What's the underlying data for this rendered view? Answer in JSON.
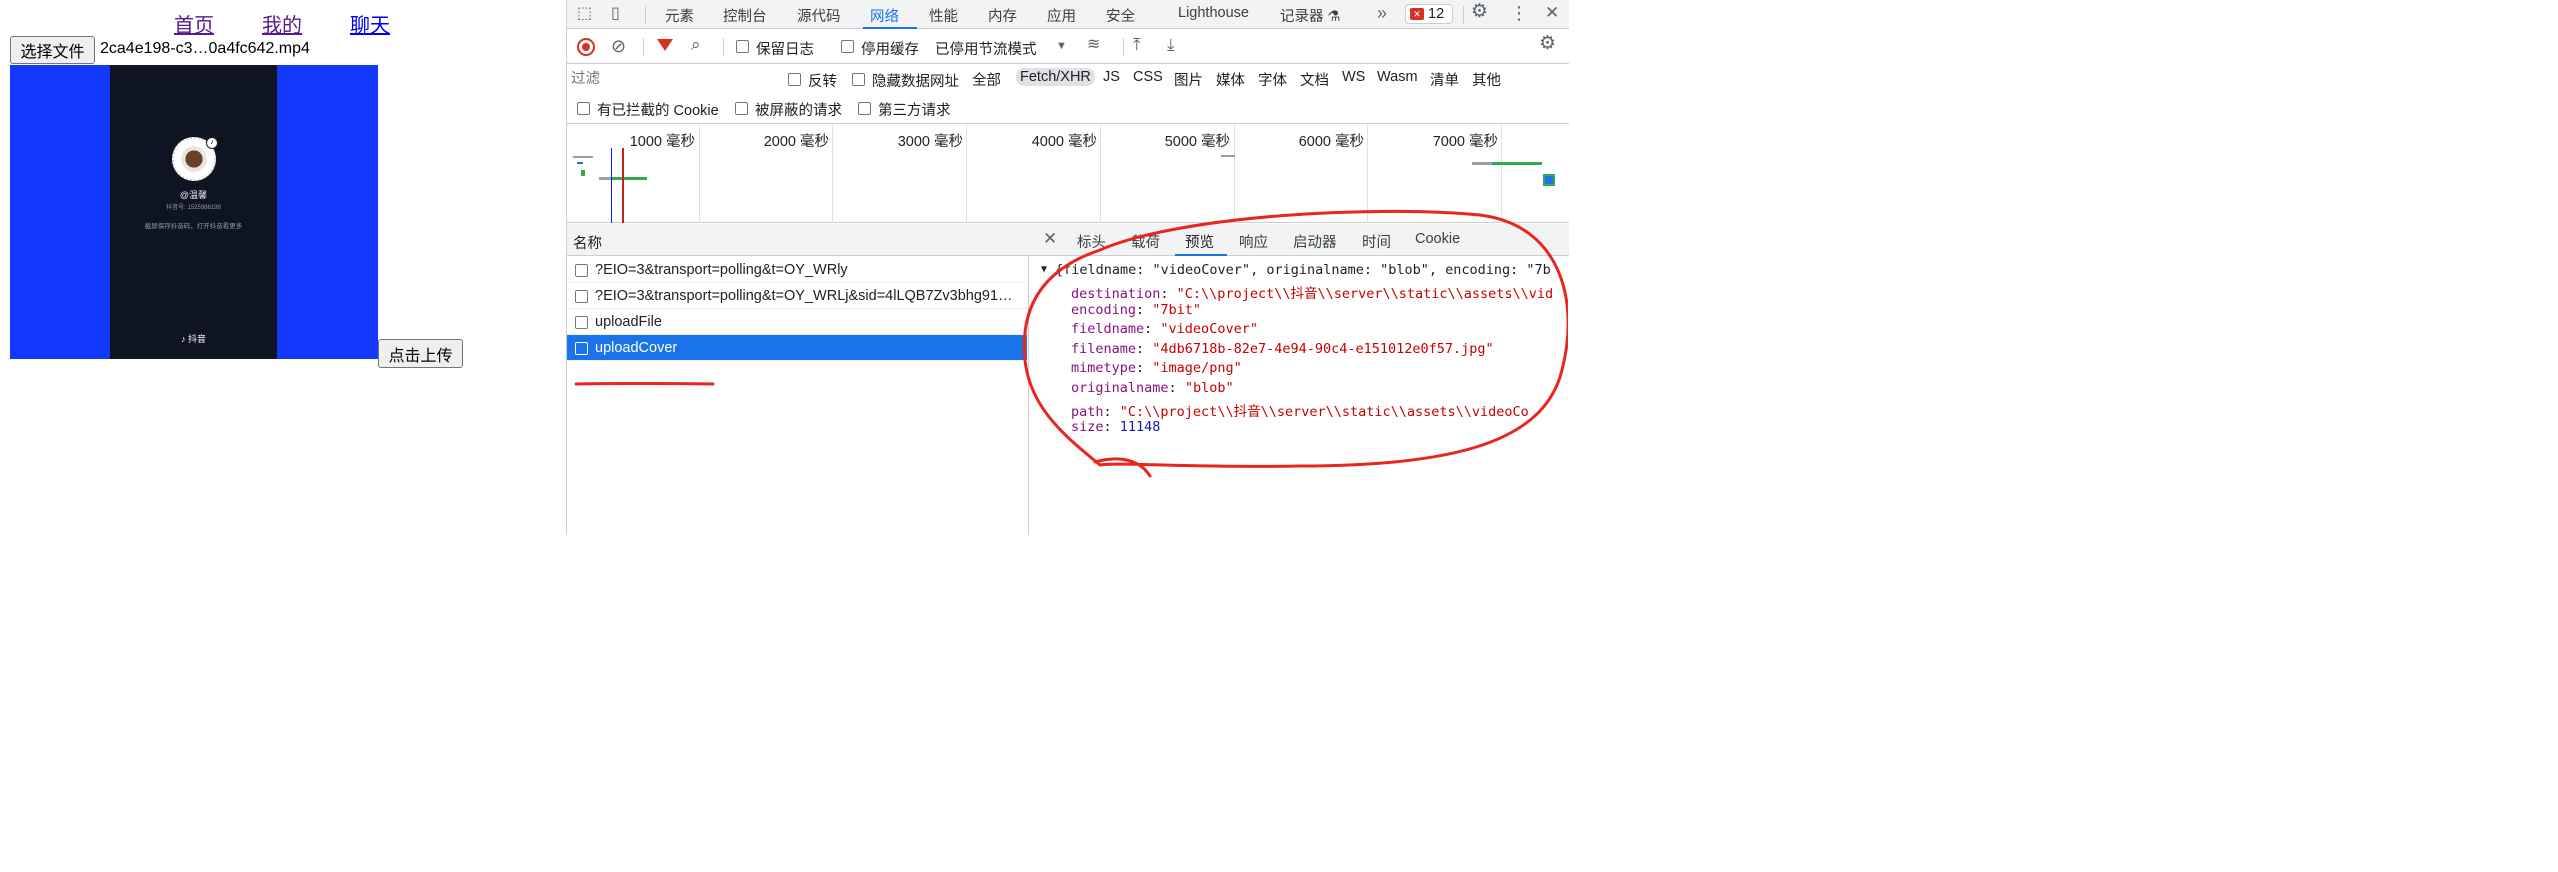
{
  "page": {
    "nav": [
      "首页",
      "我的",
      "聊天"
    ],
    "choose_file_label": "选择文件",
    "file_name": "2ca4e198-c3…0a4fc642.mp4",
    "upload_label": "点击上传",
    "video_frame": {
      "username": "@温馨",
      "douyin_id": "抖音号: 1525986198",
      "tip": "截屏保存抖音码，打开抖音看更多",
      "logo": "抖音"
    }
  },
  "devtools": {
    "tabs": [
      "元素",
      "控制台",
      "源代码",
      "网络",
      "性能",
      "内存",
      "应用",
      "安全",
      "Lighthouse",
      "记录器 ⚗"
    ],
    "active_tab": "网络",
    "error_count": "12",
    "toolbar": {
      "preserve_log": "保留日志",
      "disable_cache": "停用缓存",
      "throttle": "已停用节流模式"
    },
    "filter": {
      "placeholder": "过滤",
      "invert": "反转",
      "hide_data_urls": "隐藏数据网址",
      "types": [
        "全部",
        "Fetch/XHR",
        "JS",
        "CSS",
        "图片",
        "媒体",
        "字体",
        "文档",
        "WS",
        "Wasm",
        "清单",
        "其他"
      ],
      "active_type": "Fetch/XHR",
      "blocked_cookies": "有已拦截的 Cookie",
      "blocked_requests": "被屏蔽的请求",
      "third_party": "第三方请求"
    },
    "overview_ticks": [
      "1000 毫秒",
      "2000 毫秒",
      "3000 毫秒",
      "4000 毫秒",
      "5000 毫秒",
      "6000 毫秒",
      "7000 毫秒"
    ],
    "requests": {
      "column_name": "名称",
      "items": [
        "?EIO=3&transport=polling&t=OY_WRly",
        "?EIO=3&transport=polling&t=OY_WRLj&sid=4lLQB7Zv3bhg91…",
        "uploadFile",
        "uploadCover"
      ],
      "selected": "uploadCover"
    },
    "detail": {
      "tabs": [
        "标头",
        "载荷",
        "预览",
        "响应",
        "启动器",
        "时间",
        "Cookie"
      ],
      "active_tab": "预览",
      "summary": "{fieldname: \"videoCover\", originalname: \"blob\", encoding: \"7b",
      "fields": [
        {
          "key": "destination",
          "value": "\"C:\\\\project\\\\抖音\\\\server\\\\static\\\\assets\\\\vid"
        },
        {
          "key": "encoding",
          "value": "\"7bit\""
        },
        {
          "key": "fieldname",
          "value": "\"videoCover\""
        },
        {
          "key": "filename",
          "value": "\"4db6718b-82e7-4e94-90c4-e151012e0f57.jpg\""
        },
        {
          "key": "mimetype",
          "value": "\"image/png\""
        },
        {
          "key": "originalname",
          "value": "\"blob\""
        },
        {
          "key": "path",
          "value": "\"C:\\\\project\\\\抖音\\\\server\\\\static\\\\assets\\\\videoCo"
        },
        {
          "key": "size",
          "value": "11148"
        }
      ]
    }
  }
}
